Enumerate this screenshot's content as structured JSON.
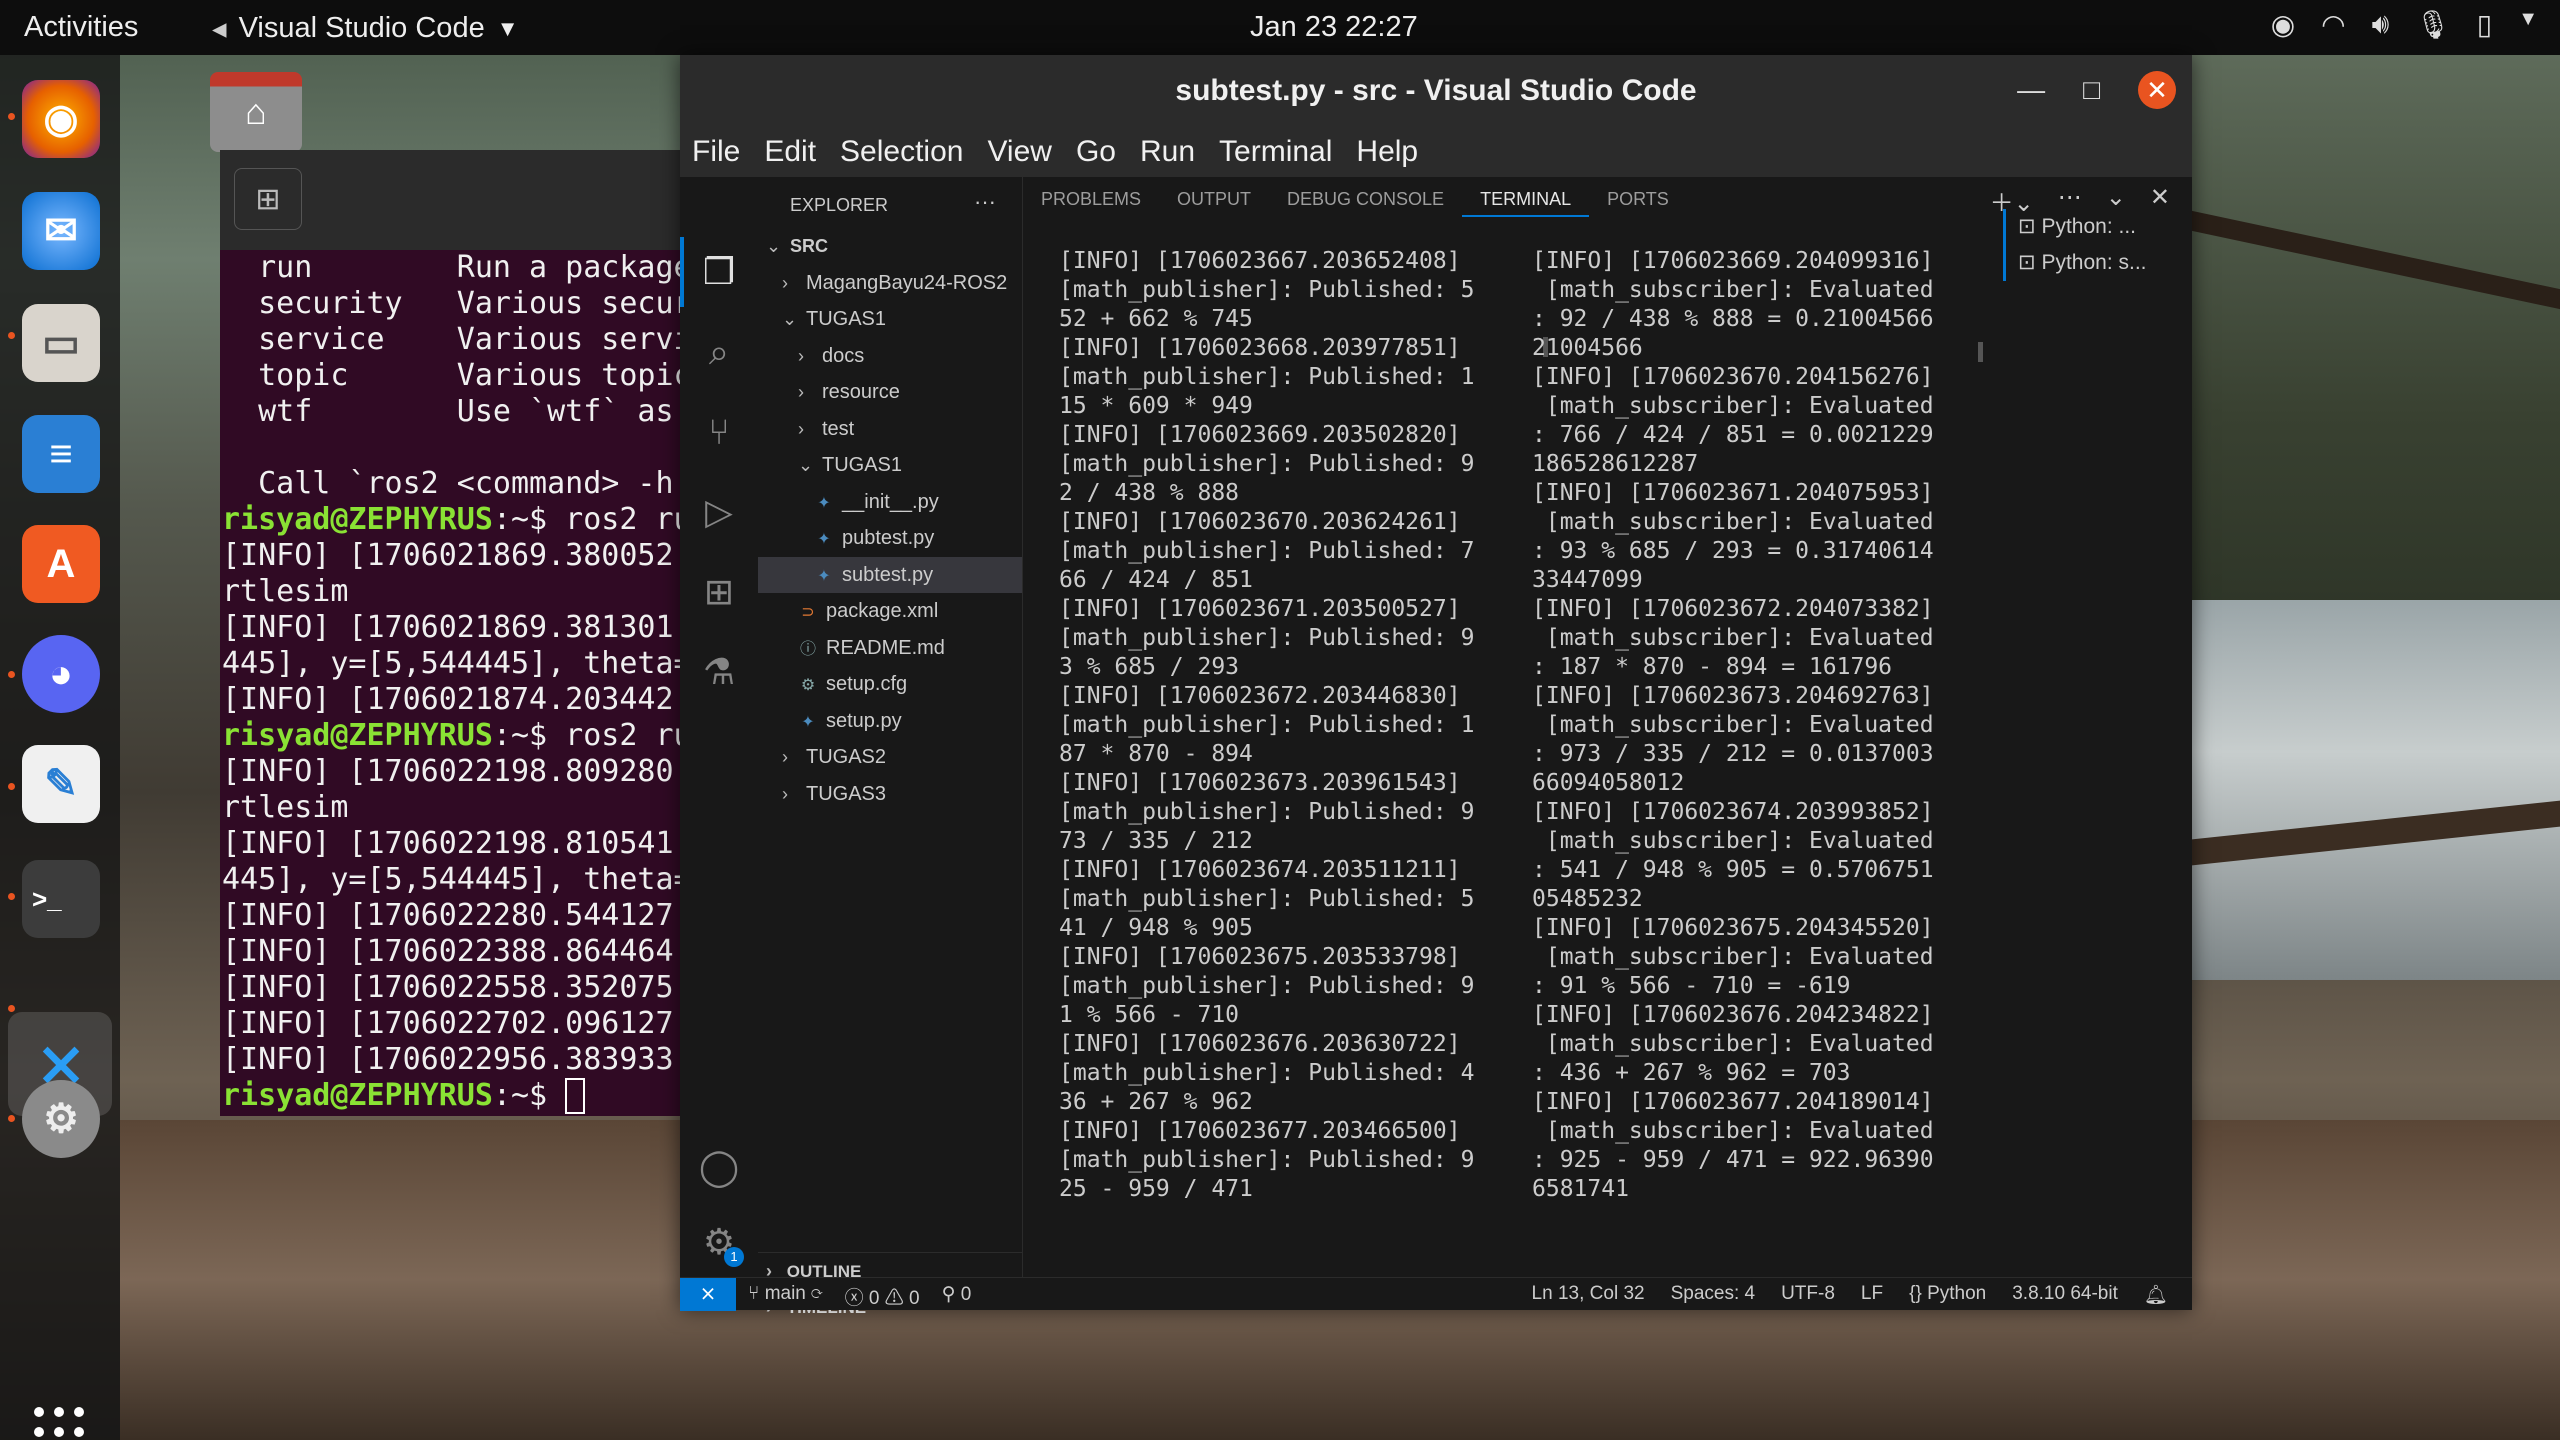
{
  "topbar": {
    "activities": "Activities",
    "app_name": "Visual Studio Code",
    "clock": "Jan 23  22:27"
  },
  "dock": {
    "apps": [
      "firefox-icon",
      "thunderbird-icon",
      "files-icon",
      "writer-icon",
      "app-center-icon",
      "discord-icon",
      "text-editor-icon",
      "terminal-icon",
      "vscode-icon",
      "settings-icon",
      "show-apps-icon"
    ]
  },
  "terminal": {
    "lines": [
      {
        "t": "  run        Run a package"
      },
      {
        "t": "  security   Various secur"
      },
      {
        "t": "  service    Various servi"
      },
      {
        "t": "  topic      Various topic"
      },
      {
        "t": "  wtf        Use `wtf` as "
      },
      {
        "t": ""
      },
      {
        "t": "  Call `ros2 <command> -h "
      },
      {
        "p": "risyad@ZEPHYRUS",
        "t": ":~$ ros2 ru"
      },
      {
        "t": "[INFO] [1706021869.380052"
      },
      {
        "t": "rtlesim"
      },
      {
        "t": "[INFO] [1706021869.381301"
      },
      {
        "t": "445], y=[5,544445], theta="
      },
      {
        "t": "[INFO] [1706021874.203442"
      },
      {
        "p": "risyad@ZEPHYRUS",
        "t": ":~$ ros2 ru"
      },
      {
        "t": "[INFO] [1706022198.809280"
      },
      {
        "t": "rtlesim"
      },
      {
        "t": "[INFO] [1706022198.810541"
      },
      {
        "t": "445], y=[5,544445], theta="
      },
      {
        "t": "[INFO] [1706022280.544127"
      },
      {
        "t": "[INFO] [1706022388.864464"
      },
      {
        "t": "[INFO] [1706022558.352075"
      },
      {
        "t": "[INFO] [1706022702.096127"
      },
      {
        "t": "[INFO] [1706022956.383933"
      },
      {
        "p": "risyad@ZEPHYRUS",
        "t": ":~$ ",
        "cursor": true
      }
    ]
  },
  "vscode": {
    "title": "subtest.py - src - Visual Studio Code",
    "menu": [
      "File",
      "Edit",
      "Selection",
      "View",
      "Go",
      "Run",
      "Terminal",
      "Help"
    ],
    "explorer": {
      "header": "EXPLORER",
      "dots": "···",
      "tree": [
        {
          "label": "SRC",
          "chev": "⌄",
          "indent": 0,
          "bold": true,
          "icon": ""
        },
        {
          "label": "MagangBayu24-ROS2",
          "chev": "›",
          "indent": 1,
          "icon": ""
        },
        {
          "label": "TUGAS1",
          "chev": "⌄",
          "indent": 1,
          "icon": ""
        },
        {
          "label": "docs",
          "chev": "›",
          "indent": 2,
          "icon": ""
        },
        {
          "label": "resource",
          "chev": "›",
          "indent": 2,
          "icon": ""
        },
        {
          "label": "test",
          "chev": "›",
          "indent": 2,
          "icon": ""
        },
        {
          "label": "TUGAS1",
          "chev": "⌄",
          "indent": 2,
          "icon": ""
        },
        {
          "label": "__init__.py",
          "chev": "",
          "indent": 3,
          "icon": "✦"
        },
        {
          "label": "pubtest.py",
          "chev": "",
          "indent": 3,
          "icon": "✦"
        },
        {
          "label": "subtest.py",
          "chev": "",
          "indent": 3,
          "icon": "✦",
          "selected": true
        },
        {
          "label": "package.xml",
          "chev": "",
          "indent": 2,
          "icon": "⊃"
        },
        {
          "label": "README.md",
          "chev": "",
          "indent": 2,
          "icon": "ⓘ"
        },
        {
          "label": "setup.cfg",
          "chev": "",
          "indent": 2,
          "icon": "⚙"
        },
        {
          "label": "setup.py",
          "chev": "",
          "indent": 2,
          "icon": "✦"
        },
        {
          "label": "TUGAS2",
          "chev": "›",
          "indent": 1,
          "icon": ""
        },
        {
          "label": "TUGAS3",
          "chev": "›",
          "indent": 1,
          "icon": ""
        }
      ],
      "outline": "OUTLINE",
      "timeline": "TIMELINE"
    },
    "panel_tabs": [
      "PROBLEMS",
      "OUTPUT",
      "DEBUG CONSOLE",
      "TERMINAL",
      "PORTS"
    ],
    "active_tab": "TERMINAL",
    "terminal_left": "[INFO] [1706023667.203652408]\n[math_publisher]: Published: 5\n52 + 662 % 745\n[INFO] [1706023668.203977851]\n[math_publisher]: Published: 1\n15 * 609 * 949\n[INFO] [1706023669.203502820]\n[math_publisher]: Published: 9\n2 / 438 % 888\n[INFO] [1706023670.203624261]\n[math_publisher]: Published: 7\n66 / 424 / 851\n[INFO] [1706023671.203500527]\n[math_publisher]: Published: 9\n3 % 685 / 293\n[INFO] [1706023672.203446830]\n[math_publisher]: Published: 1\n87 * 870 - 894\n[INFO] [1706023673.203961543]\n[math_publisher]: Published: 9\n73 / 335 / 212\n[INFO] [1706023674.203511211]\n[math_publisher]: Published: 5\n41 / 948 % 905\n[INFO] [1706023675.203533798]\n[math_publisher]: Published: 9\n1 % 566 - 710\n[INFO] [1706023676.203630722]\n[math_publisher]: Published: 4\n36 + 267 % 962\n[INFO] [1706023677.203466500]\n[math_publisher]: Published: 9\n25 - 959 / 471",
    "terminal_right": "[INFO] [1706023669.204099316]\n [math_subscriber]: Evaluated\n: 92 / 438 % 888 = 0.21004566\n21004566\n[INFO] [1706023670.204156276]\n [math_subscriber]: Evaluated\n: 766 / 424 / 851 = 0.0021229\n186528612287\n[INFO] [1706023671.204075953]\n [math_subscriber]: Evaluated\n: 93 % 685 / 293 = 0.31740614\n33447099\n[INFO] [1706023672.204073382]\n [math_subscriber]: Evaluated\n: 187 * 870 - 894 = 161796\n[INFO] [1706023673.204692763]\n [math_subscriber]: Evaluated\n: 973 / 335 / 212 = 0.0137003\n66094058012\n[INFO] [1706023674.203993852]\n [math_subscriber]: Evaluated\n: 541 / 948 % 905 = 0.5706751\n05485232\n[INFO] [1706023675.204345520]\n [math_subscriber]: Evaluated\n: 91 % 566 - 710 = -619\n[INFO] [1706023676.204234822]\n [math_subscriber]: Evaluated\n: 436 + 267 % 962 = 703\n[INFO] [1706023677.204189014]\n [math_subscriber]: Evaluated\n: 925 - 959 / 471 = 922.96390\n6581741",
    "terminal_instances": [
      "Python: ...",
      "Python: s..."
    ],
    "status": {
      "branch": "main",
      "errors": "0",
      "warnings": "0",
      "ports": "0",
      "position": "Ln 13, Col 32",
      "spaces": "Spaces: 4",
      "encoding": "UTF-8",
      "eol": "LF",
      "language": "Python",
      "interpreter": "3.8.10 64-bit"
    },
    "settings_badge": "1"
  }
}
